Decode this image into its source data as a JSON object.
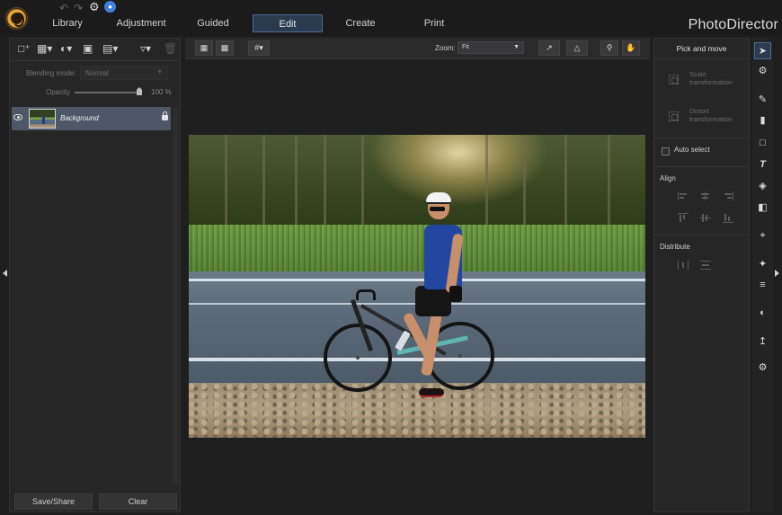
{
  "app": {
    "brand": "PhotoDirector"
  },
  "nav": {
    "tabs": [
      {
        "label": "Library"
      },
      {
        "label": "Adjustment"
      },
      {
        "label": "Guided"
      },
      {
        "label": "Edit",
        "active": true
      },
      {
        "label": "Create"
      },
      {
        "label": "Print"
      }
    ]
  },
  "layers_panel": {
    "blending_mode_label": "Blending mode:",
    "blending_mode_value": "Normal",
    "opacity_label": "Opacity",
    "opacity_value": "100 %",
    "opacity_fraction": 1.0,
    "layers": [
      {
        "name": "Background",
        "visible": true,
        "locked": true
      }
    ],
    "save_share_label": "Save/Share",
    "clear_label": "Clear"
  },
  "canvas_toolbar": {
    "zoom_label": "Zoom:",
    "zoom_value": "Fit"
  },
  "pick_panel": {
    "title": "Pick and move",
    "scale_label": "Scale transformation",
    "distort_label": "Distort transformation",
    "auto_select_label": "Auto select",
    "auto_select_checked": false,
    "align_label": "Align",
    "distribute_label": "Distribute"
  },
  "colors": {
    "accent": "#4d6a93",
    "active_tab_bg": "#2b3a4f",
    "layer_selected_bg": "#4d5766",
    "notification": "#3f7fe0"
  },
  "icons": [
    "undo-icon",
    "redo-icon",
    "gear-icon",
    "bell-icon",
    "new-layer-icon",
    "image-layer-icon",
    "adjustment-layer-icon",
    "mask-icon",
    "layer-menu-icon",
    "filter-icon",
    "trash-icon",
    "eye-icon",
    "lock-icon",
    "view-image-icon",
    "view-compare-icon",
    "grid-icon",
    "export-icon",
    "flip-icon",
    "magnifier-icon",
    "hand-icon",
    "pointer-icon",
    "selection-brush-icon",
    "brush-icon",
    "eraser-icon",
    "rectangle-icon",
    "text-icon",
    "fill-bucket-icon",
    "gradient-icon",
    "crop-icon",
    "magic-wand-icon",
    "sliders-icon",
    "contrast-icon",
    "levels-icon",
    "settings-icon"
  ]
}
